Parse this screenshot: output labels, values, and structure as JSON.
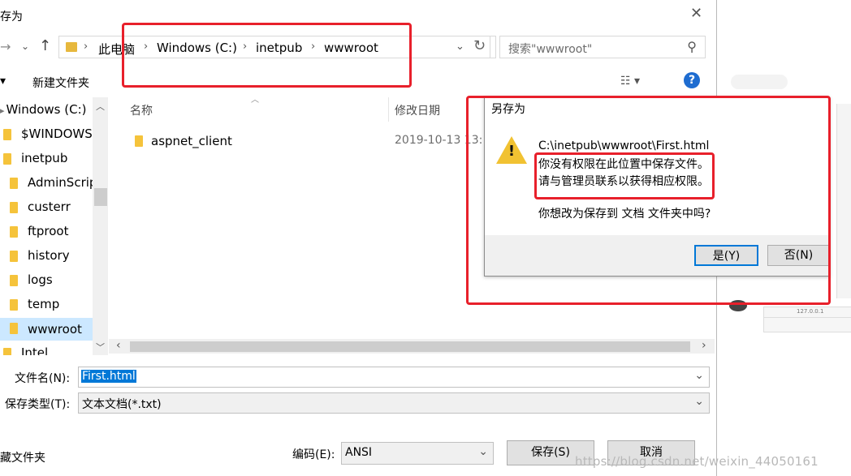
{
  "dialog": {
    "title": "存为",
    "address": [
      "此电脑",
      "Windows (C:)",
      "inetpub",
      "wwwroot"
    ],
    "search_placeholder": "搜索\"wwwroot\"",
    "toolbar": {
      "new_folder": "新建文件夹"
    },
    "nav_items": [
      "Windows (C:)",
      "$WINDOWS.",
      "inetpub",
      "AdminScrip",
      "custerr",
      "ftproot",
      "history",
      "logs",
      "temp",
      "wwwroot",
      "Intel"
    ],
    "columns": {
      "name": "名称",
      "modified": "修改日期"
    },
    "files": [
      {
        "name": "aspnet_client",
        "modified": "2019-10-13 13:"
      }
    ],
    "filename_label": "文件名(N):",
    "filename_value": "First.html",
    "filetype_label": "保存类型(T):",
    "filetype_value": "文本文档(*.txt)",
    "hide_folders": "藏文件夹",
    "encoding_label": "编码(E):",
    "encoding_value": "ANSI",
    "save_button": "保存(S)",
    "cancel_button": "取消"
  },
  "message": {
    "title": "另存为",
    "path": "C:\\inetpub\\wwwroot\\First.html",
    "line1": "你没有权限在此位置中保存文件。",
    "line2": "请与管理员联系以获得相应权限。",
    "question": "你想改为保存到 文档 文件夹中吗?",
    "yes": "是(Y)",
    "no": "否(N)"
  },
  "background": {
    "tab_text": "127.0.0.1"
  },
  "watermark": "https://blog.csdn.net/weixin_44050161",
  "colors": {
    "annotation_red": "#e8202b",
    "help_blue": "#1e6cd0",
    "folder_yellow": "#f5c33b",
    "selection_blue": "#0078d7"
  }
}
